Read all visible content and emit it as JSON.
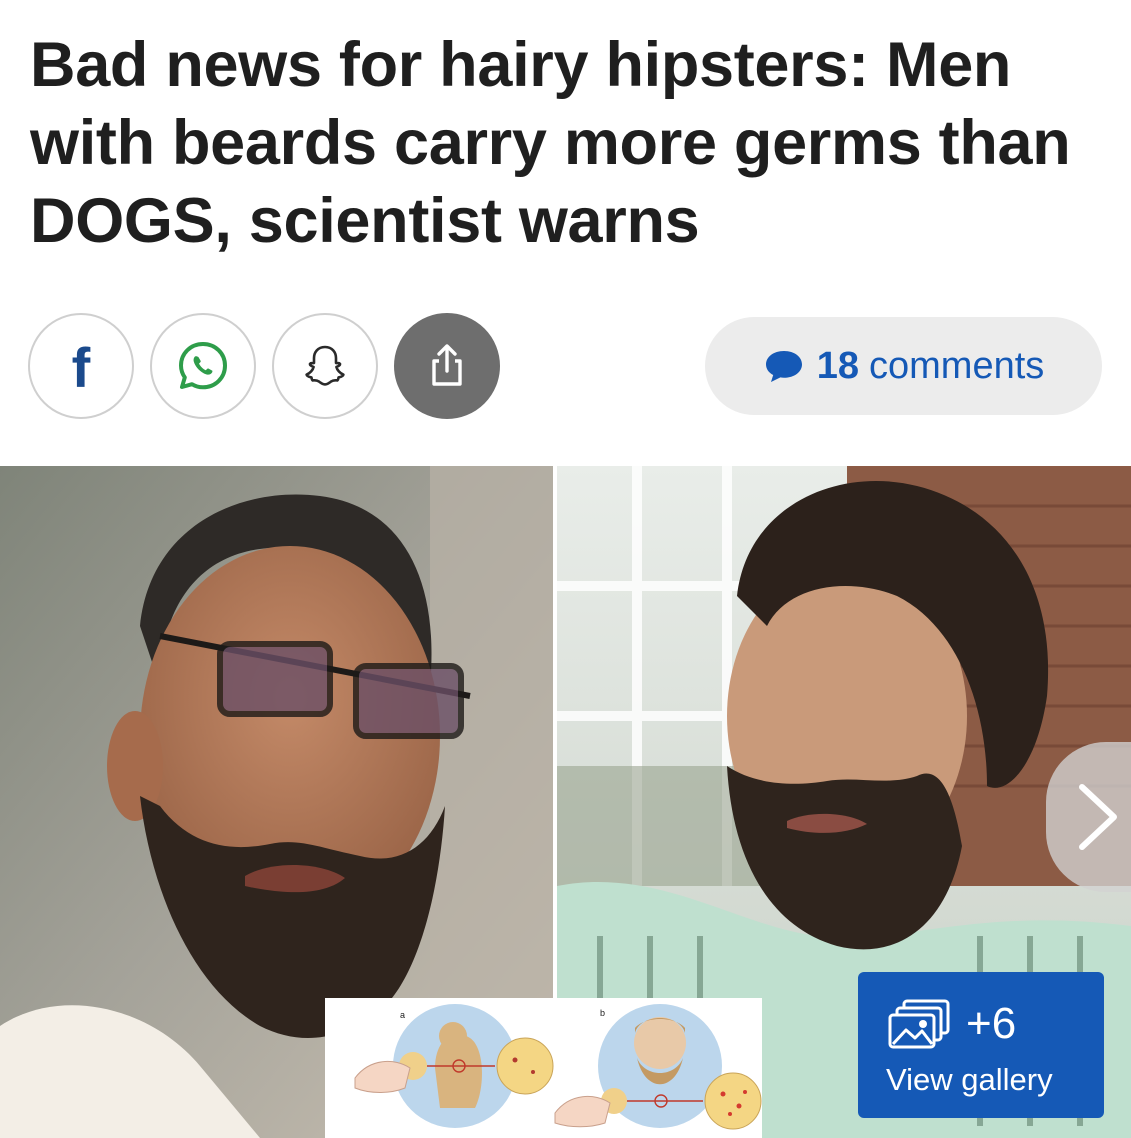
{
  "article": {
    "headline": "Bad news for hairy hipsters: Men with beards carry more germs than DOGS, scientist warns"
  },
  "share": {
    "facebook_glyph": "f",
    "icons": [
      "facebook-icon",
      "whatsapp-icon",
      "snapchat-icon",
      "share-icon"
    ]
  },
  "comments": {
    "count": "18",
    "label": "comments",
    "icon": "speech-bubble-icon"
  },
  "gallery": {
    "count_label": "+6",
    "view_label": "View gallery",
    "icon": "gallery-icon",
    "next_icon": "chevron-right-icon",
    "inset_labels": {
      "a": "a",
      "b": "b"
    }
  },
  "colors": {
    "accent_blue": "#1559b6",
    "headline_text": "#1f1f1f",
    "pill_bg": "#ececec",
    "share_more_bg": "#6e6e6e"
  }
}
